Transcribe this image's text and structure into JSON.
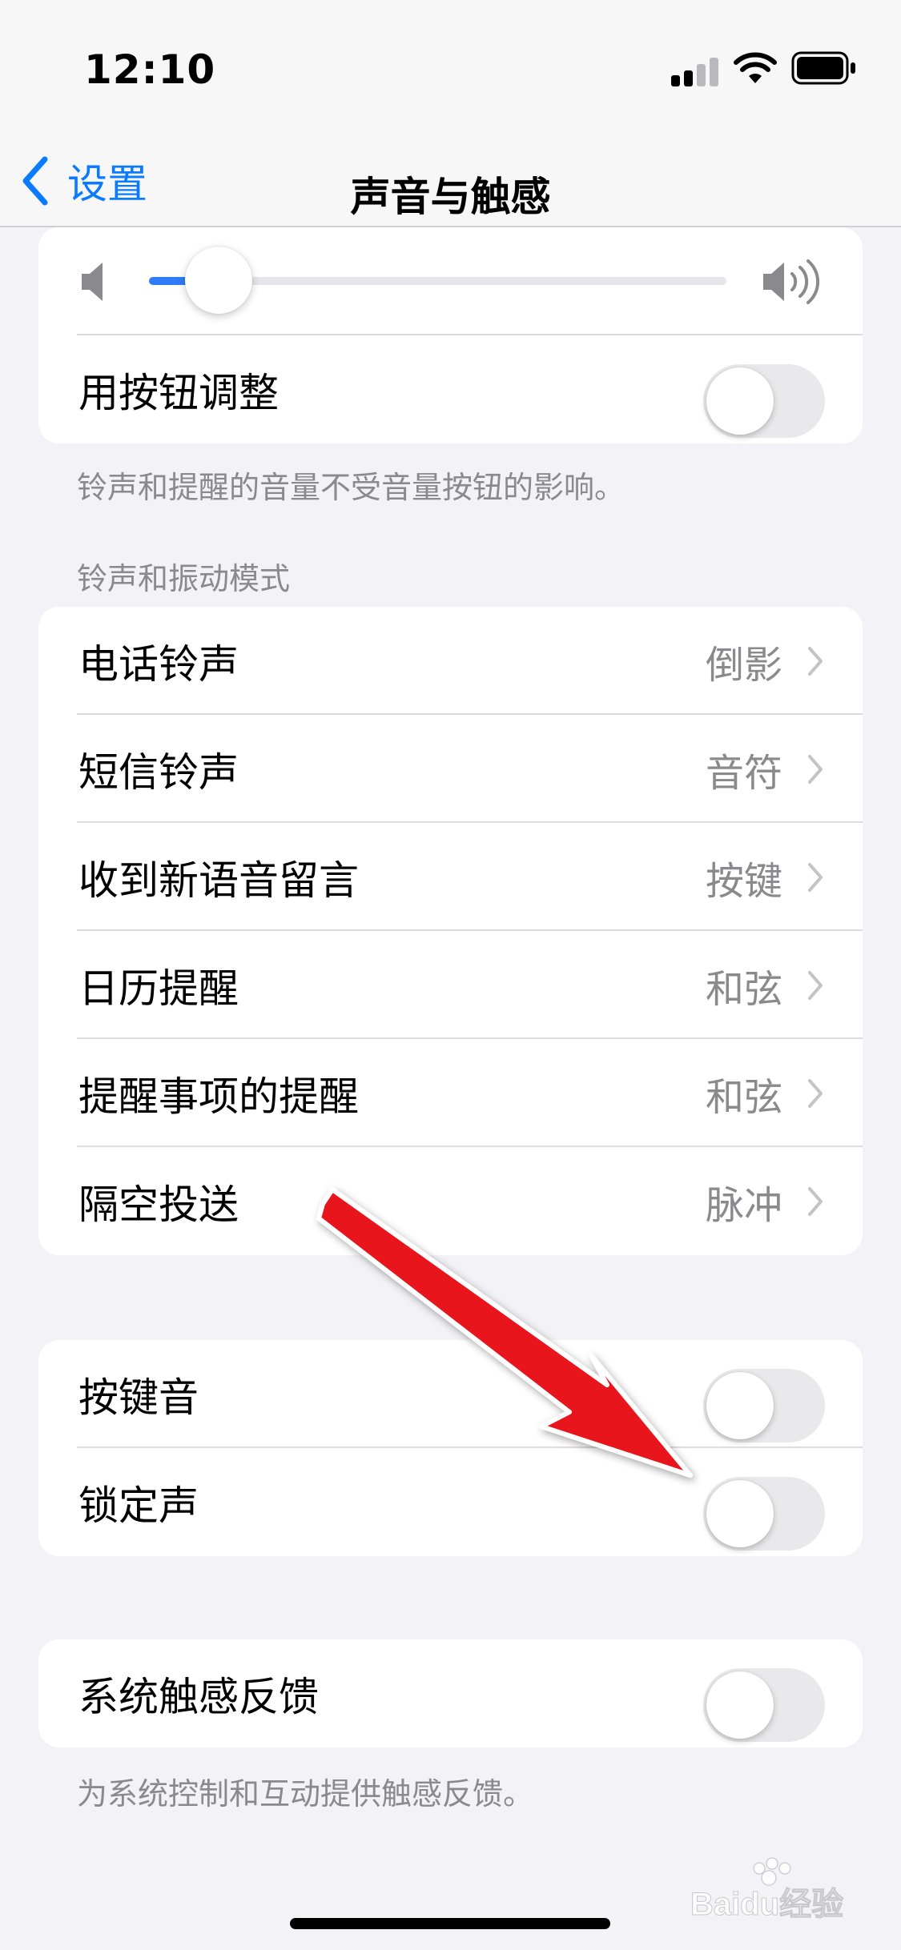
{
  "status_bar": {
    "time": "12:10"
  },
  "nav": {
    "back_label": "设置",
    "title": "声音与触感"
  },
  "volume": {
    "level": 0.09,
    "use_buttons_label": "用按钮调整",
    "use_buttons_on": false,
    "footnote": "铃声和提醒的音量不受音量按钮的影响。"
  },
  "ringtone_section": {
    "header": "铃声和振动模式",
    "items": [
      {
        "label": "电话铃声",
        "value": "倒影"
      },
      {
        "label": "短信铃声",
        "value": "音符"
      },
      {
        "label": "收到新语音留言",
        "value": "按键"
      },
      {
        "label": "日历提醒",
        "value": "和弦"
      },
      {
        "label": "提醒事项的提醒",
        "value": "和弦"
      },
      {
        "label": "隔空投送",
        "value": "脉冲"
      }
    ]
  },
  "toggles_section": {
    "keyboard_clicks_label": "按键音",
    "keyboard_clicks_on": false,
    "lock_sound_label": "锁定声",
    "lock_sound_on": false
  },
  "haptics_section": {
    "label": "系统触感反馈",
    "on": false,
    "footnote": "为系统控制和互动提供触感反馈。"
  },
  "annotation": {
    "color": "#e8141a"
  },
  "colors": {
    "accent": "#0a7aff",
    "toggle_off": "#e9e9eb",
    "slider_fill": "#2e7cf6"
  },
  "watermark": {
    "text": "Baidu经验"
  }
}
